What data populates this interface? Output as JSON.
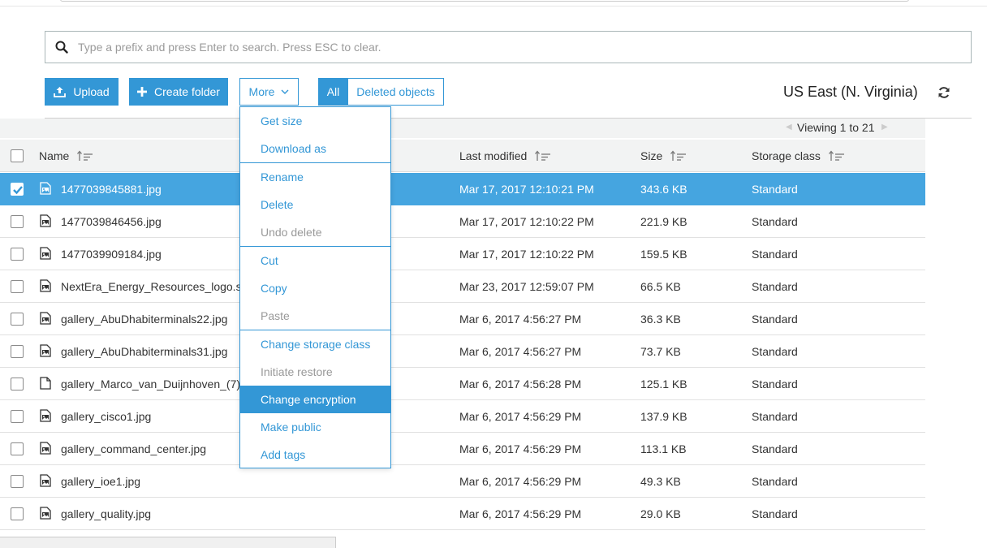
{
  "search": {
    "placeholder": "Type a prefix and press Enter to search. Press ESC to clear."
  },
  "toolbar": {
    "upload_label": "Upload",
    "create_folder_label": "Create folder",
    "more_label": "More",
    "all_label": "All",
    "deleted_objects_label": "Deleted objects"
  },
  "region": {
    "label": "US East (N. Virginia)"
  },
  "pagination": {
    "viewing": "Viewing 1 to 21"
  },
  "table": {
    "headers": {
      "name": "Name",
      "last_modified": "Last modified",
      "size": "Size",
      "storage_class": "Storage class"
    },
    "rows": [
      {
        "name": "1477039845881.jpg",
        "modified": "Mar 17, 2017 12:10:21 PM",
        "size": "343.6 KB",
        "storage": "Standard",
        "icon": "image-file-icon"
      },
      {
        "name": "1477039846456.jpg",
        "modified": "Mar 17, 2017 12:10:22 PM",
        "size": "221.9 KB",
        "storage": "Standard",
        "icon": "image-file-icon"
      },
      {
        "name": "1477039909184.jpg",
        "modified": "Mar 17, 2017 12:10:22 PM",
        "size": "159.5 KB",
        "storage": "Standard",
        "icon": "image-file-icon"
      },
      {
        "name": "NextEra_Energy_Resources_logo.s",
        "modified": "Mar 23, 2017 12:59:07 PM",
        "size": "66.5 KB",
        "storage": "Standard",
        "icon": "image-file-icon"
      },
      {
        "name": "gallery_AbuDhabiterminals22.jpg",
        "modified": "Mar 6, 2017 4:56:27 PM",
        "size": "36.3 KB",
        "storage": "Standard",
        "icon": "image-file-icon"
      },
      {
        "name": "gallery_AbuDhabiterminals31.jpg",
        "modified": "Mar 6, 2017 4:56:27 PM",
        "size": "73.7 KB",
        "storage": "Standard",
        "icon": "image-file-icon"
      },
      {
        "name": "gallery_Marco_van_Duijnhoven_(7)",
        "modified": "Mar 6, 2017 4:56:28 PM",
        "size": "125.1 KB",
        "storage": "Standard",
        "icon": "file-icon"
      },
      {
        "name": "gallery_cisco1.jpg",
        "modified": "Mar 6, 2017 4:56:29 PM",
        "size": "137.9 KB",
        "storage": "Standard",
        "icon": "image-file-icon"
      },
      {
        "name": "gallery_command_center.jpg",
        "modified": "Mar 6, 2017 4:56:29 PM",
        "size": "113.1 KB",
        "storage": "Standard",
        "icon": "image-file-icon"
      },
      {
        "name": "gallery_ioe1.jpg",
        "modified": "Mar 6, 2017 4:56:29 PM",
        "size": "49.3 KB",
        "storage": "Standard",
        "icon": "image-file-icon"
      },
      {
        "name": "gallery_quality.jpg",
        "modified": "Mar 6, 2017 4:56:29 PM",
        "size": "29.0 KB",
        "storage": "Standard",
        "icon": "image-file-icon"
      }
    ]
  },
  "more_menu": {
    "items": [
      {
        "label": "Get size",
        "state": "enabled"
      },
      {
        "label": "Download as",
        "state": "enabled"
      },
      {
        "label": "Rename",
        "state": "enabled"
      },
      {
        "label": "Delete",
        "state": "enabled"
      },
      {
        "label": "Undo delete",
        "state": "disabled"
      },
      {
        "label": "Cut",
        "state": "enabled"
      },
      {
        "label": "Copy",
        "state": "enabled"
      },
      {
        "label": "Paste",
        "state": "disabled"
      },
      {
        "label": "Change storage class",
        "state": "enabled"
      },
      {
        "label": "Initiate restore",
        "state": "disabled"
      },
      {
        "label": "Change encryption",
        "state": "active"
      },
      {
        "label": "Make public",
        "state": "enabled"
      },
      {
        "label": "Add tags",
        "state": "enabled"
      }
    ]
  },
  "colors": {
    "accent": "#3397d6",
    "selected_row": "#45a5e0",
    "header_bg": "#f2f3f3"
  }
}
